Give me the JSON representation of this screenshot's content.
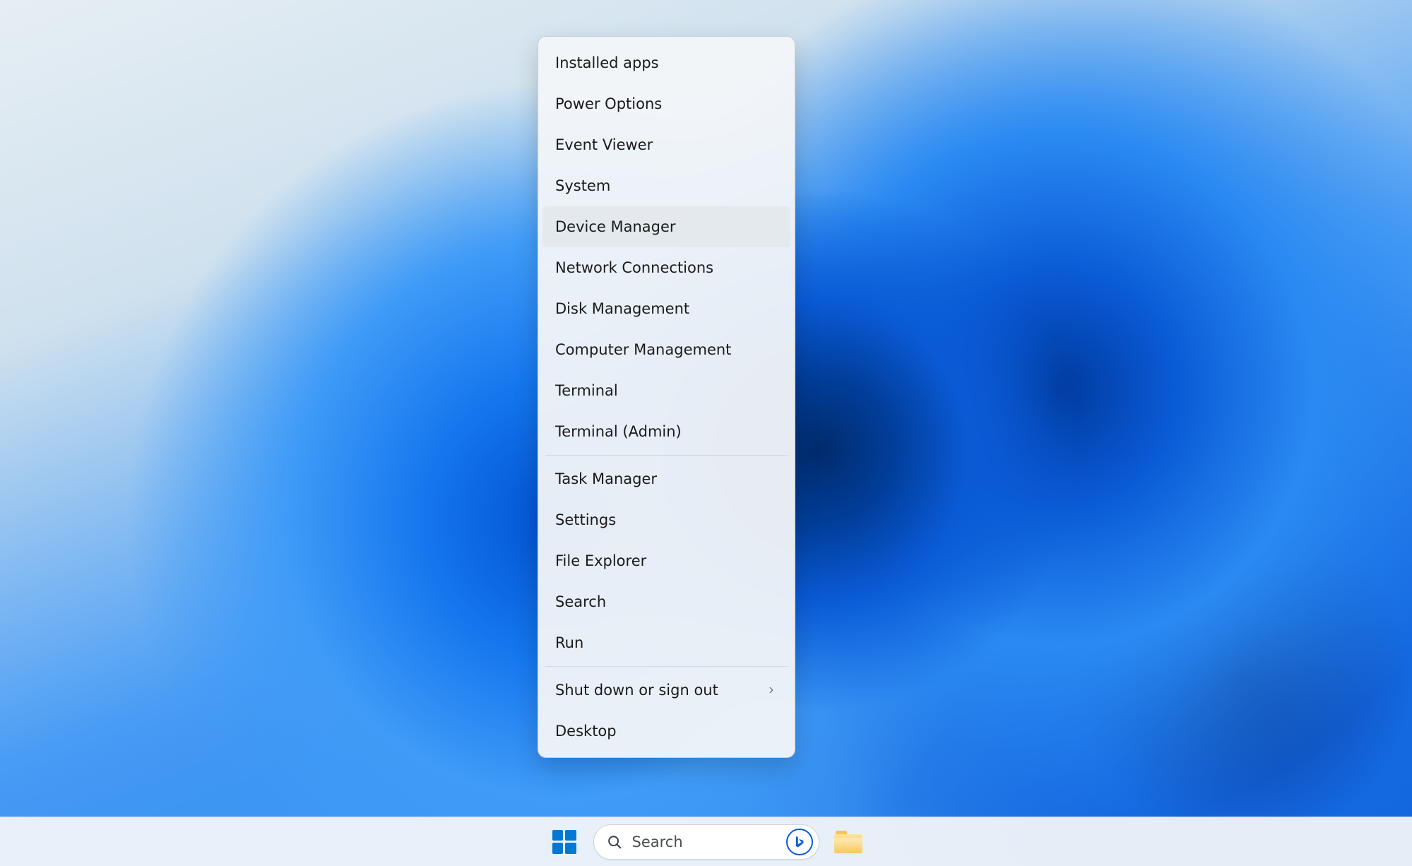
{
  "context_menu": {
    "groups": [
      {
        "items": [
          {
            "label": "Installed apps",
            "has_submenu": false,
            "hover": false
          },
          {
            "label": "Power Options",
            "has_submenu": false,
            "hover": false
          },
          {
            "label": "Event Viewer",
            "has_submenu": false,
            "hover": false
          },
          {
            "label": "System",
            "has_submenu": false,
            "hover": false
          },
          {
            "label": "Device Manager",
            "has_submenu": false,
            "hover": true
          },
          {
            "label": "Network Connections",
            "has_submenu": false,
            "hover": false
          },
          {
            "label": "Disk Management",
            "has_submenu": false,
            "hover": false
          },
          {
            "label": "Computer Management",
            "has_submenu": false,
            "hover": false
          },
          {
            "label": "Terminal",
            "has_submenu": false,
            "hover": false
          },
          {
            "label": "Terminal (Admin)",
            "has_submenu": false,
            "hover": false
          }
        ]
      },
      {
        "items": [
          {
            "label": "Task Manager",
            "has_submenu": false,
            "hover": false
          },
          {
            "label": "Settings",
            "has_submenu": false,
            "hover": false
          },
          {
            "label": "File Explorer",
            "has_submenu": false,
            "hover": false
          },
          {
            "label": "Search",
            "has_submenu": false,
            "hover": false
          },
          {
            "label": "Run",
            "has_submenu": false,
            "hover": false
          }
        ]
      },
      {
        "items": [
          {
            "label": "Shut down or sign out",
            "has_submenu": true,
            "hover": false
          },
          {
            "label": "Desktop",
            "has_submenu": false,
            "hover": false
          }
        ]
      }
    ]
  },
  "taskbar": {
    "search_placeholder": "Search",
    "items": [
      {
        "name": "start",
        "icon": "windows-logo-icon"
      },
      {
        "name": "search",
        "icon": "search-icon"
      },
      {
        "name": "file-explorer",
        "icon": "folder-icon"
      }
    ]
  },
  "colors": {
    "accent": "#0078d4",
    "menu_bg": "#f3f5f8",
    "menu_hover": "#e4e7eb"
  }
}
